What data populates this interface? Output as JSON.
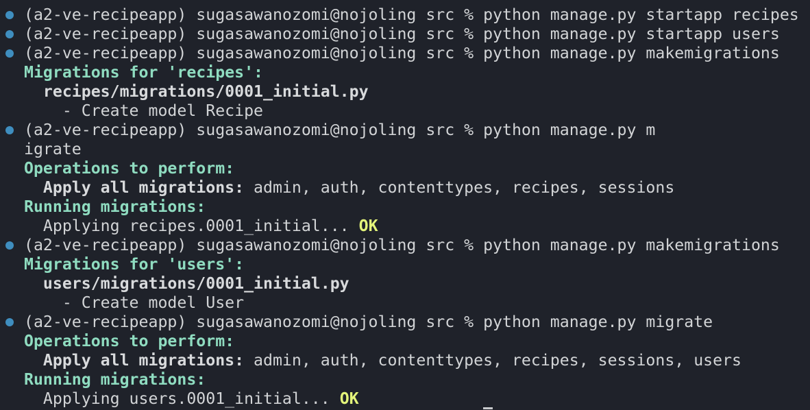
{
  "terminal": {
    "lines": [
      {
        "prompt": true,
        "segments": [
          {
            "s": "n",
            "t": "(a2-ve-recipeapp) sugasawanozomi@nojoling src % python manage.py startapp recipes"
          }
        ]
      },
      {
        "prompt": true,
        "segments": [
          {
            "s": "n",
            "t": "(a2-ve-recipeapp) sugasawanozomi@nojoling src % python manage.py startapp users"
          }
        ]
      },
      {
        "prompt": true,
        "segments": [
          {
            "s": "n",
            "t": "(a2-ve-recipeapp) sugasawanozomi@nojoling src % python manage.py makemigrations"
          }
        ]
      },
      {
        "prompt": false,
        "segments": [
          {
            "s": "hd",
            "t": "Migrations for 'recipes':"
          }
        ]
      },
      {
        "prompt": false,
        "segments": [
          {
            "s": "n",
            "t": "  "
          },
          {
            "s": "b",
            "t": "recipes/migrations/0001_initial.py"
          }
        ]
      },
      {
        "prompt": false,
        "segments": [
          {
            "s": "n",
            "t": "    - Create model Recipe"
          }
        ]
      },
      {
        "prompt": true,
        "segments": [
          {
            "s": "n",
            "t": "(a2-ve-recipeapp) sugasawanozomi@nojoling src % python manage.py m"
          }
        ]
      },
      {
        "prompt": false,
        "segments": [
          {
            "s": "n",
            "t": "igrate"
          }
        ]
      },
      {
        "prompt": false,
        "segments": [
          {
            "s": "hd",
            "t": "Operations to perform:"
          }
        ]
      },
      {
        "prompt": false,
        "segments": [
          {
            "s": "n",
            "t": "  "
          },
          {
            "s": "b",
            "t": "Apply all migrations:"
          },
          {
            "s": "n",
            "t": " admin, auth, contenttypes, recipes, sessions"
          }
        ]
      },
      {
        "prompt": false,
        "segments": [
          {
            "s": "hd",
            "t": "Running migrations:"
          }
        ]
      },
      {
        "prompt": false,
        "segments": [
          {
            "s": "n",
            "t": "  Applying recipes.0001_initial... "
          },
          {
            "s": "ok",
            "t": "OK"
          }
        ]
      },
      {
        "prompt": true,
        "segments": [
          {
            "s": "n",
            "t": "(a2-ve-recipeapp) sugasawanozomi@nojoling src % python manage.py makemigrations"
          }
        ]
      },
      {
        "prompt": false,
        "segments": [
          {
            "s": "hd",
            "t": "Migrations for 'users':"
          }
        ]
      },
      {
        "prompt": false,
        "segments": [
          {
            "s": "n",
            "t": "  "
          },
          {
            "s": "b",
            "t": "users/migrations/0001_initial.py"
          }
        ]
      },
      {
        "prompt": false,
        "segments": [
          {
            "s": "n",
            "t": "    - Create model User"
          }
        ]
      },
      {
        "prompt": true,
        "segments": [
          {
            "s": "n",
            "t": "(a2-ve-recipeapp) sugasawanozomi@nojoling src % python manage.py migrate"
          }
        ]
      },
      {
        "prompt": false,
        "segments": [
          {
            "s": "hd",
            "t": "Operations to perform:"
          }
        ]
      },
      {
        "prompt": false,
        "segments": [
          {
            "s": "n",
            "t": "  "
          },
          {
            "s": "b",
            "t": "Apply all migrations:"
          },
          {
            "s": "n",
            "t": " admin, auth, contenttypes, recipes, sessions, users"
          }
        ]
      },
      {
        "prompt": false,
        "segments": [
          {
            "s": "hd",
            "t": "Running migrations:"
          }
        ]
      },
      {
        "prompt": false,
        "segments": [
          {
            "s": "n",
            "t": "  Applying users.0001_initial... "
          },
          {
            "s": "ok",
            "t": "OK"
          }
        ]
      }
    ]
  },
  "colors": {
    "background": "#1f222a",
    "heading": "#8fdcc0",
    "ok": "#e3f47a",
    "prompt_dot": "#3f8ebf"
  }
}
